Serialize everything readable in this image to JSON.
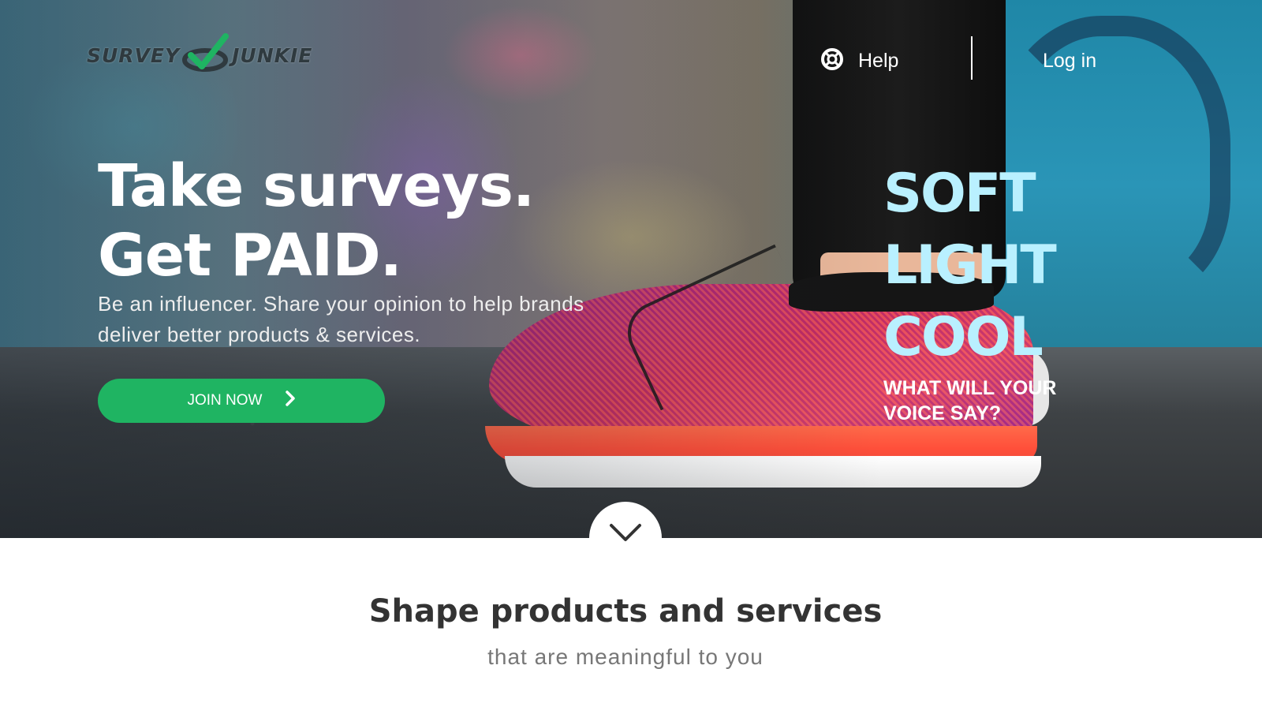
{
  "header": {
    "logo_text_left": "SURVEY",
    "logo_text_right": "JUNKIE",
    "help_label": "Help",
    "login_label": "Log in"
  },
  "hero": {
    "title_line1": "Take surveys.",
    "title_line2": "Get PAID.",
    "subtitle_line1": "Be an influencer. Share your opinion to help brands",
    "subtitle_line2": "deliver better products & services.",
    "cta_label": "JOIN NOW",
    "ad_words": [
      "SOFT",
      "LIGHT",
      "COOL"
    ],
    "ad_tagline_line1": "WHAT WILL YOUR",
    "ad_tagline_line2": "VOICE SAY?"
  },
  "section": {
    "title": "Shape products and services",
    "subtitle": "that are meaningful to you"
  },
  "colors": {
    "brand_green": "#1fb462",
    "ad_text": "#b9f0ff",
    "logo_dark": "#2f3a3f"
  },
  "icons": {
    "help": "lifebuoy-icon",
    "cta_arrow": "chevron-right-icon",
    "scroll": "chevron-down-icon",
    "logo_mark": "checkmark-icon"
  }
}
